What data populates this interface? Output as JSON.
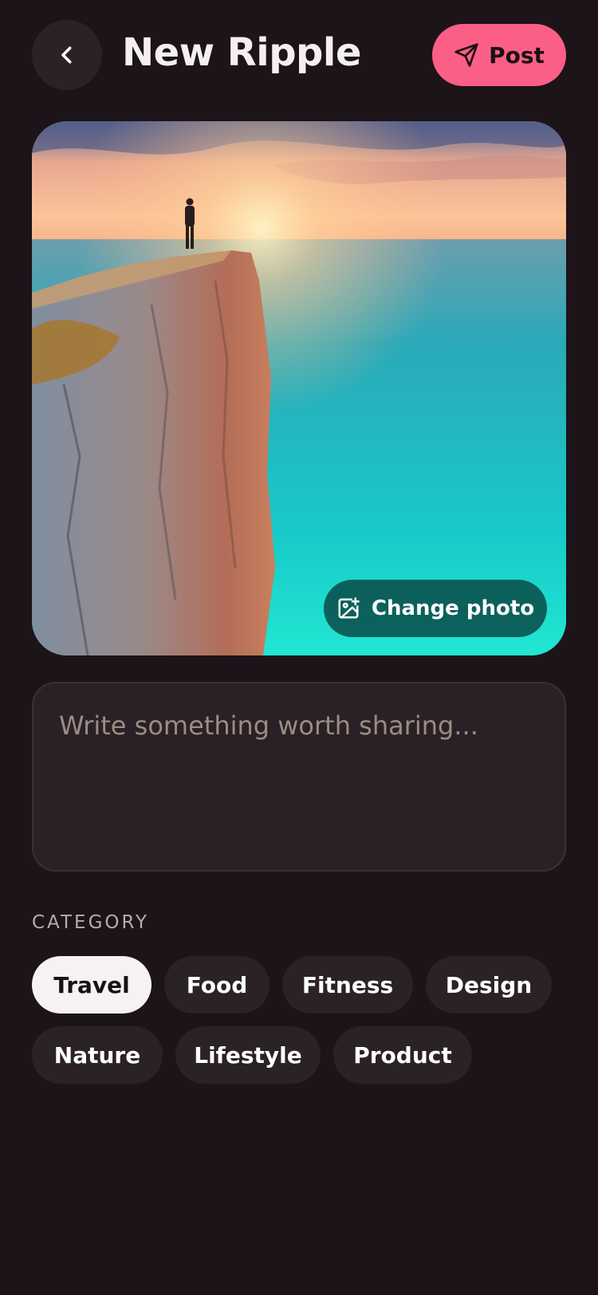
{
  "header": {
    "title": "New Ripple",
    "post_label": "Post"
  },
  "photo": {
    "change_label": "Change photo"
  },
  "caption": {
    "placeholder": "Write something worth sharing...",
    "value": ""
  },
  "category": {
    "label": "CATEGORY",
    "selected": "Travel",
    "chips": [
      "Travel",
      "Food",
      "Fitness",
      "Design",
      "Nature",
      "Lifestyle",
      "Product"
    ]
  },
  "colors": {
    "background": "#1c1418",
    "accent": "#fb5f86",
    "chip": "#2b2227",
    "chip_selected": "#f6f2f4"
  },
  "icons": {
    "back": "chevron-left-icon",
    "post": "send-icon",
    "change_photo": "image-plus-icon"
  }
}
